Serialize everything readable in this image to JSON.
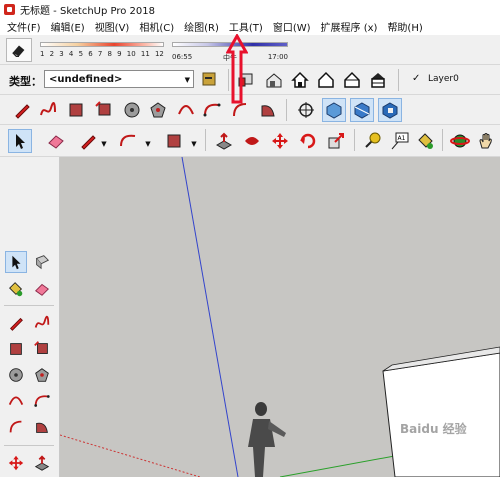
{
  "window": {
    "title": "无标题 - SketchUp Pro 2018"
  },
  "menu": [
    "文件(F)",
    "编辑(E)",
    "视图(V)",
    "相机(C)",
    "绘图(R)",
    "工具(T)",
    "窗口(W)",
    "扩展程序 (x)",
    "帮助(H)"
  ],
  "shadow_settings": {
    "month_ticks": [
      "1",
      "2",
      "3",
      "4",
      "5",
      "6",
      "7",
      "8",
      "9",
      "10",
      "11",
      "12"
    ],
    "time_start": "06:55",
    "time_mid": "中午",
    "time_end": "17:00"
  },
  "entity_info": {
    "type_label": "类型：",
    "type_value": "<undefined>"
  },
  "layers": {
    "current_layer": "Layer0",
    "check": "✓"
  },
  "watermark": "Baidu 经验",
  "colors": {
    "accent_red": "#e8112d",
    "axis_blue": "#3344cc",
    "axis_green": "#2aa02a",
    "axis_red": "#cc3333",
    "viewport_bg": "#c7c6c3"
  }
}
